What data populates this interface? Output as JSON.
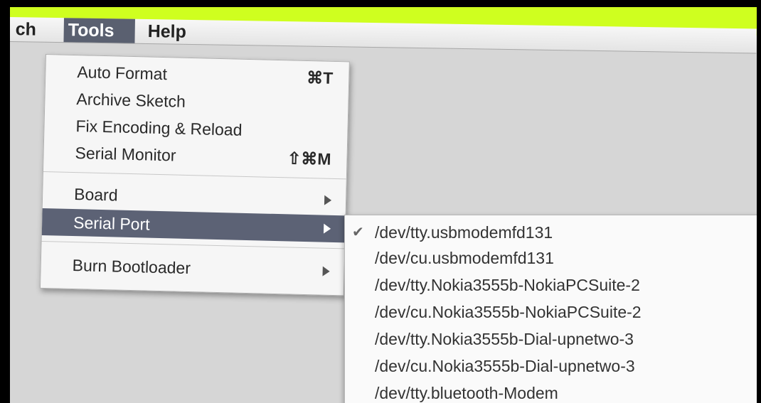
{
  "menubar": {
    "items": [
      {
        "label": "ch"
      },
      {
        "label": "Tools"
      },
      {
        "label": "Help"
      }
    ]
  },
  "tools_menu": {
    "items": [
      {
        "label": "Auto Format",
        "shortcut": "⌘T"
      },
      {
        "label": "Archive Sketch",
        "shortcut": ""
      },
      {
        "label": "Fix Encoding & Reload",
        "shortcut": ""
      },
      {
        "label": "Serial Monitor",
        "shortcut": "⇧⌘M"
      },
      {
        "label": "Board",
        "shortcut": ""
      },
      {
        "label": "Serial Port",
        "shortcut": ""
      },
      {
        "label": "Burn Bootloader",
        "shortcut": ""
      }
    ]
  },
  "serial_port_submenu": {
    "check_mark": "✔",
    "items": [
      {
        "label": "/dev/tty.usbmodemfd131",
        "checked": true
      },
      {
        "label": "/dev/cu.usbmodemfd131",
        "checked": false
      },
      {
        "label": "/dev/tty.Nokia3555b-NokiaPCSuite-2",
        "checked": false
      },
      {
        "label": "/dev/cu.Nokia3555b-NokiaPCSuite-2",
        "checked": false
      },
      {
        "label": "/dev/tty.Nokia3555b-Dial-upnetwo-3",
        "checked": false
      },
      {
        "label": "/dev/cu.Nokia3555b-Dial-upnetwo-3",
        "checked": false
      },
      {
        "label": "/dev/tty.bluetooth-Modem",
        "checked": false
      }
    ]
  },
  "colors": {
    "accent_strip": "#cfff1f",
    "menu_highlight": "#5c6275"
  }
}
